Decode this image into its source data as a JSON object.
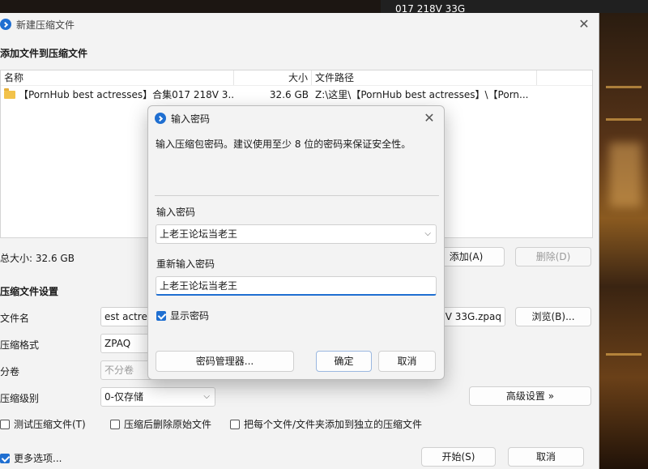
{
  "background": {
    "top_text": "017 218V 33G"
  },
  "main": {
    "title": "新建压缩文件",
    "add_section_title": "添加文件到压缩文件",
    "columns": {
      "name": "名称",
      "size": "大小",
      "path": "文件路径"
    },
    "files": [
      {
        "name": "【PornHub best actresses】合集017 218V 3...",
        "size": "32.6 GB",
        "path": "Z:\\这里\\【PornHub best actresses】\\【Porn..."
      }
    ],
    "total_size": "总大小: 32.6 GB",
    "add_button": "添加(A)",
    "delete_button": "删除(D)",
    "settings_title": "压缩文件设置",
    "filename_label": "文件名",
    "filename_left": "est actress",
    "filename_right": "8V 33G.zpaq",
    "browse_button": "浏览(B)...",
    "format_label": "压缩格式",
    "format_value": "ZPAQ",
    "split_label": "分卷",
    "split_value": "不分卷",
    "level_label": "压缩级别",
    "level_value": "0-仅存储",
    "advanced_button": "高级设置 »",
    "check_test": "测试压缩文件(T)",
    "check_delete_after": "压缩后删除原始文件",
    "check_each_separate": "把每个文件/文件夹添加到独立的压缩文件",
    "more_options": "更多选项...",
    "start_button": "开始(S)",
    "cancel_button": "取消"
  },
  "dialog": {
    "title": "输入密码",
    "description": "输入压缩包密码。建议使用至少 8 位的密码来保证安全性。",
    "password_label": "输入密码",
    "password_value": "上老王论坛当老王",
    "reenter_label": "重新输入密码",
    "reenter_value": "上老王论坛当老王",
    "show_password": "显示密码",
    "manager_button": "密码管理器...",
    "ok_button": "确定",
    "cancel_button": "取消"
  }
}
